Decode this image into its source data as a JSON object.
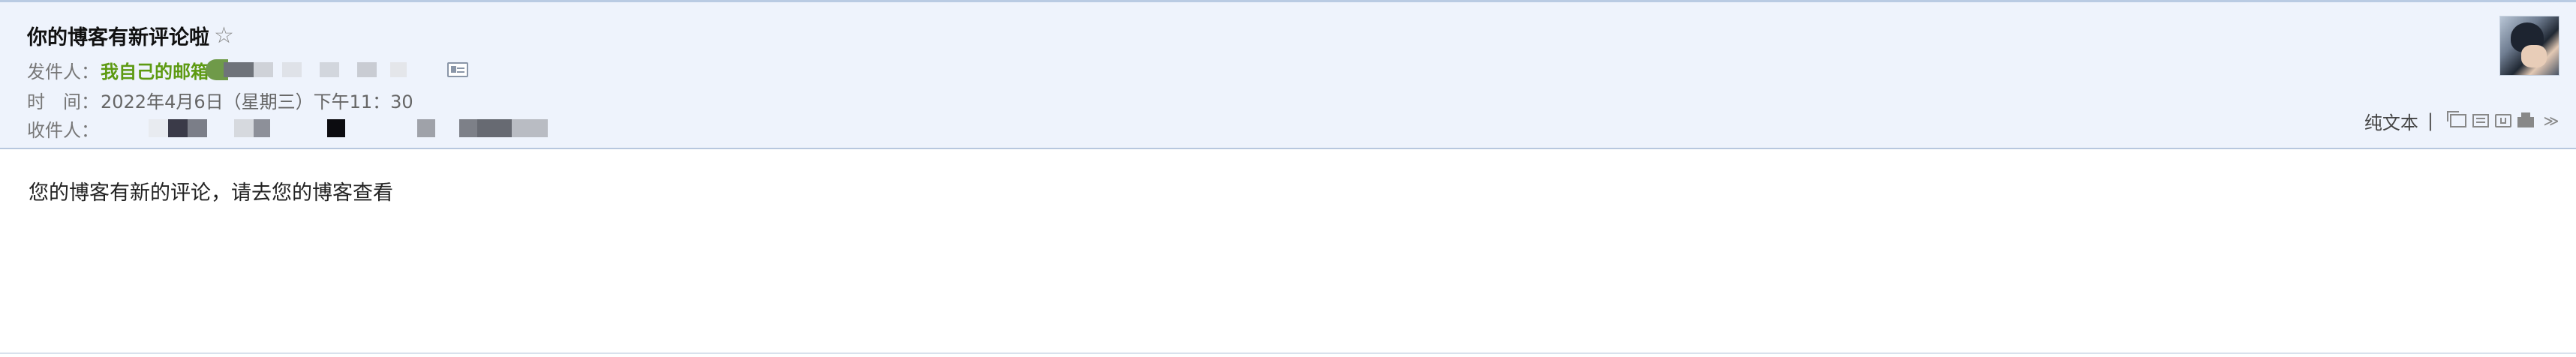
{
  "email": {
    "subject": "你的博客有新评论啦",
    "star_icon": "☆",
    "from_label": "发件人：",
    "from_name": "我自己的邮箱",
    "time_label": "时　间：",
    "time_value": "2022年4月6日（星期三）下午11：30",
    "to_label": "收件人：",
    "body_text": "您的博客有新的评论，请去您的博客查看"
  },
  "toolbar": {
    "plaintext_label": "纯文本",
    "separator": "|",
    "more_icon": "≫"
  },
  "icons": [
    "star-icon",
    "contact-card-icon",
    "new-window-icon",
    "note-icon",
    "save-icon",
    "print-icon",
    "more-icon"
  ],
  "colors": {
    "header_bg": "#eef3fc",
    "sender_green": "#5d9a12",
    "border": "#b7c7de"
  }
}
